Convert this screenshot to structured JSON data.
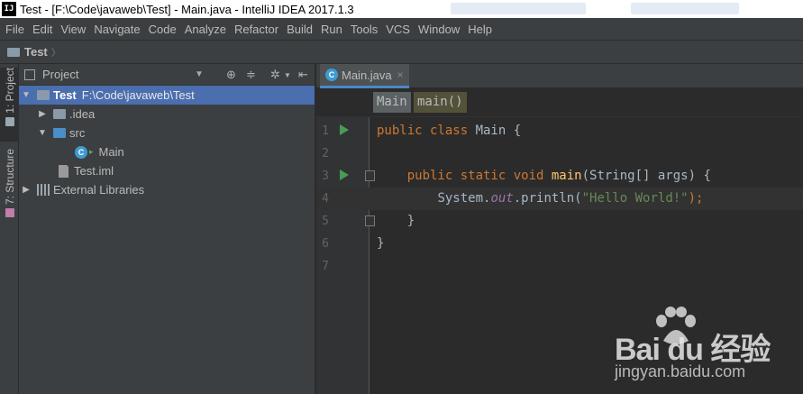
{
  "window": {
    "title": "Test - [F:\\Code\\javaweb\\Test] - Main.java - IntelliJ IDEA 2017.1.3",
    "app_icon": "IJ"
  },
  "menu": [
    "File",
    "Edit",
    "View",
    "Navigate",
    "Code",
    "Analyze",
    "Refactor",
    "Build",
    "Run",
    "Tools",
    "VCS",
    "Window",
    "Help"
  ],
  "navbar": {
    "crumb": "Test",
    "separator": "〉"
  },
  "tool_strip": {
    "project_tab": "1: Project",
    "structure_tab": "7: Structure"
  },
  "project_panel": {
    "title": "Project",
    "tree": {
      "root_label": "Test",
      "root_path": "F:\\Code\\javaweb\\Test",
      "idea": ".idea",
      "src": "src",
      "main_class": "Main",
      "iml": "Test.iml",
      "ext_libs": "External Libraries"
    }
  },
  "editor": {
    "tab_label": "Main.java",
    "tab_close": "×",
    "breadcrumb_class": "Main",
    "breadcrumb_method": "main()",
    "line_numbers": [
      "1",
      "2",
      "3",
      "4",
      "5",
      "6",
      "7"
    ],
    "code": {
      "l1_kw": "public class ",
      "l1_rest": "Main {",
      "l3_indent": "    ",
      "l3_kw": "public static void ",
      "l3_fn": "main",
      "l3_rest": "(String[] args) {",
      "l4_indent": "        ",
      "l4_pre": "System.",
      "l4_field": "out",
      "l4_mid": ".println(",
      "l4_str": "\"Hello World!\"",
      "l4_end": ");",
      "l5_text": "    }",
      "l6_text": "}"
    }
  },
  "watermark": {
    "brand": "Bai du 经验",
    "sub": "jingyan.baidu.com"
  },
  "colors": {
    "selection": "#4b6eaf",
    "keyword": "#cc7832",
    "function": "#ffc66d",
    "string": "#6a8759",
    "static_field": "#9876aa",
    "run_marker": "#499c54"
  }
}
